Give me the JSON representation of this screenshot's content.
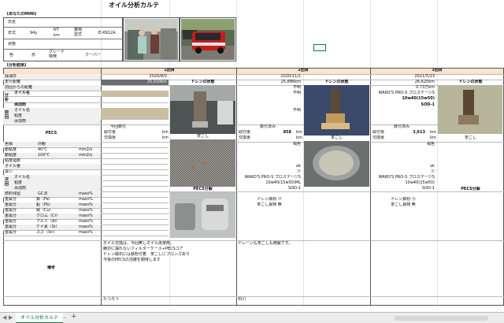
{
  "sheet_title": "オイル分析カルテ",
  "your_mini": "【あなたのMINI】",
  "owner": {
    "label": "氏名",
    "value": ""
  },
  "car": {
    "year_label": "年式",
    "year_value": "94y",
    "km_label": "km",
    "km_value": "",
    "nt_label": "NT",
    "grade_label": "車両\n型式",
    "grade_value": "E-XN12A",
    "state_label": "状態",
    "state_value": "",
    "color_label": "色",
    "color_value": "赤",
    "grade2_label": "グレード\n特徴",
    "grade2_value": "クーパー"
  },
  "analysis_header": "【分析結果】",
  "columns": [
    {
      "title": "1回目",
      "date": "2020/8/3",
      "km": "25,010km"
    },
    {
      "title": "2回目",
      "date": "2020/11/1",
      "km": "25,886km"
    },
    {
      "title": "3回目",
      "date": "2021/5/23",
      "km": "26,620km"
    }
  ],
  "row_labels": {
    "sampling": "採油日",
    "mileage": "走行距離",
    "since_change": "前回からの距離",
    "analysis": "分析",
    "oil_name": "オイル名",
    "additive": "添加剤",
    "prev": "前回",
    "prev_oil": "オイル名",
    "prev_visc": "粘度",
    "prev_add": "添加剤",
    "pecs": "PECS",
    "color": "色相",
    "appearance": "外観",
    "visc40": "動粘度",
    "visc40b": "40℃",
    "visc100": "動粘度",
    "visc100b": "100℃",
    "visc_index": "粘度指数",
    "oil_amount": "オイル量",
    "smell": "臭い",
    "next": "次回",
    "next_oil": "オイル名",
    "next_visc": "粘度",
    "next_add": "添加剤",
    "fuel": "燃料残留",
    "fuel_unit": "GC法",
    "metal": "金属分",
    "fe": "鉄（Fe）",
    "pb": "鉛（Pb）",
    "cu": "銅（Cu）",
    "cr": "クロム（Cr）",
    "al": "アルミ（Al）",
    "si": "ケイ素（Si）",
    "sn": "スズ（Sn）",
    "unit_mm2": "mm2/s",
    "unit_mass": "mass%",
    "remarks": "備考"
  },
  "col1": {
    "drain_header": "ドレンの状態",
    "pecs_val": "今回数付",
    "pecs_num_label": "取付後",
    "pecs_exch": "交換後",
    "unit_km": "km",
    "strainer": "茶こし",
    "pecs_analysis": "PECS分解",
    "remarks": "オイル交換は、今回無しオイル再使用。\n絶対に漏れないフィルターケース+PECSコア\nドレン磁石には鉄粉付着　茶こしにブロンズあり\n今後のPECSの活躍を期待します",
    "author": "たつろう"
  },
  "col2": {
    "drain_header": "ドレンの状態",
    "fumei1": "不明",
    "fumei2": "不明",
    "fumei3": "不明",
    "pecs_val": "数付済み",
    "pecs_num_label": "取付後",
    "pecs_num": "858",
    "pecs_exch": "交換後",
    "unit_km": "km",
    "strainer": "茶こし",
    "color": "褐色",
    "ok": "ok",
    "less": "少",
    "next_oil": "WAKO'S PRO-S プロステージS",
    "next_visc": "10w40(15w50)ML",
    "next_add": "SOD-1",
    "drain_result": "ドレン鉄粉 少",
    "strainer_result": "茶こし異物 無",
    "remarks": "ドレーンも茶こしも綺麗です。",
    "author": "石川"
  },
  "col3": {
    "drain_header": "ドレンの状態",
    "km_diff": "0.73万km",
    "oil_name": "WAKO'S PRO-S プロステージS",
    "visc": "10w40(15w50)",
    "add": "SOD-1",
    "pecs_val": "数付済み",
    "pecs_num_label": "取付後",
    "pecs_num": "3,613",
    "pecs_exch": "交換後",
    "unit_km": "km",
    "strainer": "茶こし",
    "color": "褐色",
    "ok": "ok",
    "less": "少",
    "next_oil": "WAKO'S PRO-S プロステージS",
    "next_visc": "10w40(15w50)",
    "next_add": "SOD-1",
    "pecs_analysis": "PECS分解",
    "drain_result": "ドレン鉄粉 小",
    "strainer_result": "茶こし異物 無"
  },
  "sheet_tab": "オイル分析カルテ",
  "tab_add": "+",
  "tab_more": "..."
}
